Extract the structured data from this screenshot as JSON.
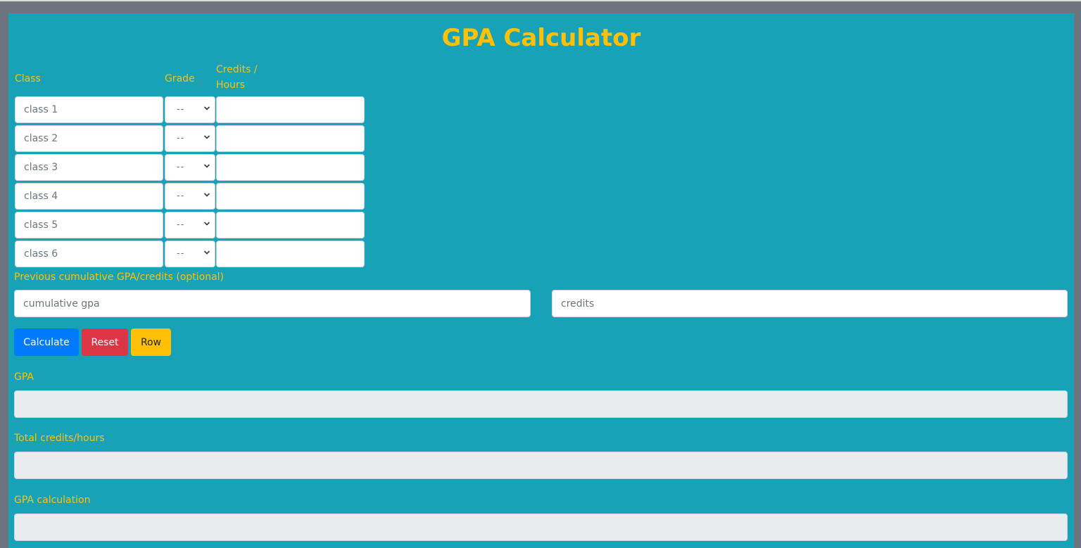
{
  "header": {
    "title": "GPA Calculator"
  },
  "columns": {
    "class": "Class",
    "grade": "Grade",
    "credits_line1": "Credits /",
    "credits_line2": "Hours"
  },
  "rows": [
    {
      "class_placeholder": "class 1",
      "grade": "--",
      "credits": ""
    },
    {
      "class_placeholder": "class 2",
      "grade": "--",
      "credits": ""
    },
    {
      "class_placeholder": "class 3",
      "grade": "--",
      "credits": ""
    },
    {
      "class_placeholder": "class 4",
      "grade": "--",
      "credits": ""
    },
    {
      "class_placeholder": "class 5",
      "grade": "--",
      "credits": ""
    },
    {
      "class_placeholder": "class 6",
      "grade": "--",
      "credits": ""
    }
  ],
  "previous": {
    "label": "Previous cumulative GPA/credits (optional)",
    "gpa_placeholder": "cumulative gpa",
    "credits_placeholder": "credits"
  },
  "buttons": {
    "calculate": "Calculate",
    "reset": "Reset",
    "row": "Row"
  },
  "results": {
    "gpa_label": "GPA",
    "gpa_value": "",
    "total_label": "Total credits/hours",
    "total_value": "",
    "calc_label": "GPA calculation",
    "calc_value": ""
  },
  "colors": {
    "background": "#17a2b8",
    "frame": "#6c757d",
    "accent": "#ffc107",
    "primary": "#007bff",
    "danger": "#dc3545"
  }
}
